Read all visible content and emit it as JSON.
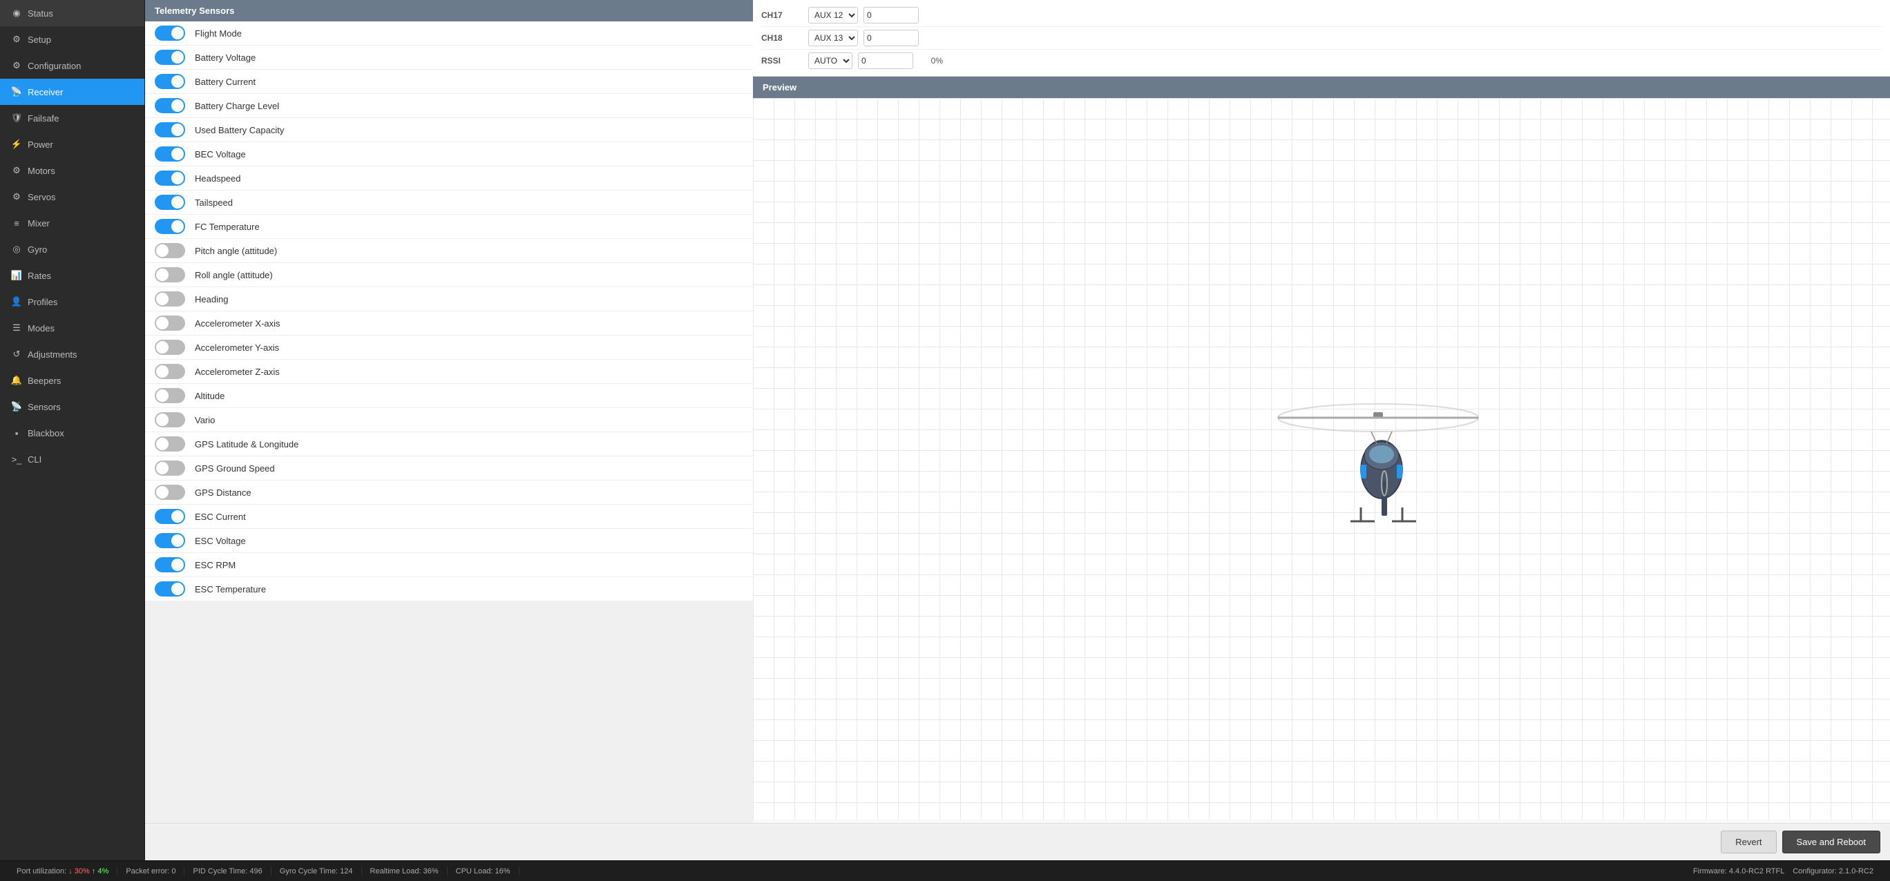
{
  "sidebar": {
    "items": [
      {
        "id": "status",
        "label": "Status",
        "icon": "◉",
        "active": false
      },
      {
        "id": "setup",
        "label": "Setup",
        "icon": "⚙",
        "active": false
      },
      {
        "id": "configuration",
        "label": "Configuration",
        "icon": "⚙",
        "active": false
      },
      {
        "id": "receiver",
        "label": "Receiver",
        "icon": "📡",
        "active": true
      },
      {
        "id": "failsafe",
        "label": "Failsafe",
        "icon": "🛡",
        "active": false
      },
      {
        "id": "power",
        "label": "Power",
        "icon": "⚡",
        "active": false
      },
      {
        "id": "motors",
        "label": "Motors",
        "icon": "🔧",
        "active": false
      },
      {
        "id": "servos",
        "label": "Servos",
        "icon": "🔩",
        "active": false
      },
      {
        "id": "mixer",
        "label": "Mixer",
        "icon": "≡",
        "active": false
      },
      {
        "id": "gyro",
        "label": "Gyro",
        "icon": "◎",
        "active": false
      },
      {
        "id": "rates",
        "label": "Rates",
        "icon": "📊",
        "active": false
      },
      {
        "id": "profiles",
        "label": "Profiles",
        "icon": "👤",
        "active": false
      },
      {
        "id": "modes",
        "label": "Modes",
        "icon": "☰",
        "active": false
      },
      {
        "id": "adjustments",
        "label": "Adjustments",
        "icon": "🔄",
        "active": false
      },
      {
        "id": "beepers",
        "label": "Beepers",
        "icon": "🔔",
        "active": false
      },
      {
        "id": "sensors",
        "label": "Sensors",
        "icon": "📡",
        "active": false
      },
      {
        "id": "blackbox",
        "label": "Blackbox",
        "icon": "⬛",
        "active": false
      },
      {
        "id": "cli",
        "label": "CLI",
        "icon": ">_",
        "active": false
      }
    ]
  },
  "telemetry": {
    "title": "Telemetry Sensors",
    "sensors": [
      {
        "label": "Flight Mode",
        "on": true
      },
      {
        "label": "Battery Voltage",
        "on": true
      },
      {
        "label": "Battery Current",
        "on": true
      },
      {
        "label": "Battery Charge Level",
        "on": true
      },
      {
        "label": "Used Battery Capacity",
        "on": true
      },
      {
        "label": "BEC Voltage",
        "on": true
      },
      {
        "label": "Headspeed",
        "on": true
      },
      {
        "label": "Tailspeed",
        "on": true
      },
      {
        "label": "FC Temperature",
        "on": true
      },
      {
        "label": "Pitch angle (attitude)",
        "on": false
      },
      {
        "label": "Roll angle (attitude)",
        "on": false
      },
      {
        "label": "Heading",
        "on": false
      },
      {
        "label": "Accelerometer X-axis",
        "on": false
      },
      {
        "label": "Accelerometer Y-axis",
        "on": false
      },
      {
        "label": "Accelerometer Z-axis",
        "on": false
      },
      {
        "label": "Altitude",
        "on": false
      },
      {
        "label": "Vario",
        "on": false
      },
      {
        "label": "GPS Latitude & Longitude",
        "on": false
      },
      {
        "label": "GPS Ground Speed",
        "on": false
      },
      {
        "label": "GPS Distance",
        "on": false
      },
      {
        "label": "ESC Current",
        "on": true
      },
      {
        "label": "ESC Voltage",
        "on": true
      },
      {
        "label": "ESC RPM",
        "on": true
      },
      {
        "label": "ESC Temperature",
        "on": true
      }
    ]
  },
  "channels": [
    {
      "label": "CH17",
      "select": "AUX 12",
      "value": "0"
    },
    {
      "label": "CH18",
      "select": "AUX 13",
      "value": "0"
    }
  ],
  "rssi": {
    "label": "RSSI",
    "select": "AUTO",
    "value": "0",
    "pct": "0%"
  },
  "preview": {
    "title": "Preview"
  },
  "bottom_bar": {
    "revert_label": "Revert",
    "save_label": "Save and Reboot"
  },
  "status_bar": {
    "port_util_label": "Port utilization:",
    "port_down": "↓ 30%",
    "port_up": "↑ 4%",
    "packet_error_label": "Packet error:",
    "packet_error_value": "0",
    "pid_cycle_label": "PID Cycle Time:",
    "pid_cycle_value": "496",
    "gyro_cycle_label": "Gyro Cycle Time:",
    "gyro_cycle_value": "124",
    "realtime_label": "Realtime Load:",
    "realtime_value": "36%",
    "cpu_label": "CPU Load:",
    "cpu_value": "16%",
    "firmware_label": "Firmware:",
    "firmware_value": "4.4.0-RC2 RTFL",
    "configurator_label": "Configurator:",
    "configurator_value": "2.1.0-RC2"
  }
}
